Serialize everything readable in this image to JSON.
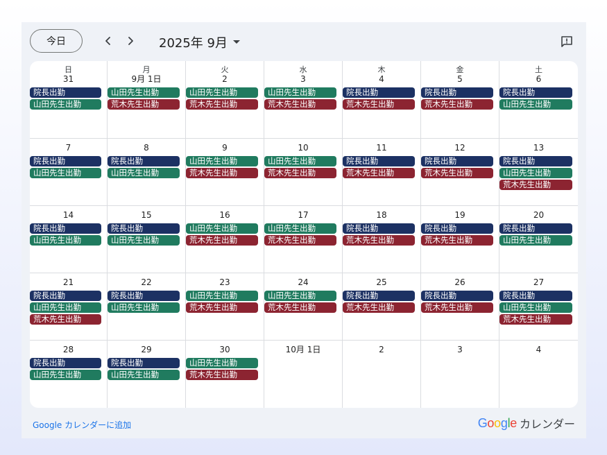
{
  "toolbar": {
    "today_label": "今日",
    "month_title": "2025年 9月"
  },
  "weekdays": [
    "日",
    "月",
    "火",
    "水",
    "木",
    "金",
    "土"
  ],
  "colors": {
    "director": "#1c3163",
    "yamada": "#207b5f",
    "araki": "#8c2431"
  },
  "weeks": [
    [
      {
        "day": "31",
        "events": [
          {
            "label": "院長出勤",
            "type": "director"
          },
          {
            "label": "山田先生出勤",
            "type": "yamada"
          }
        ]
      },
      {
        "day": "9月 1日",
        "events": [
          {
            "label": "山田先生出勤",
            "type": "yamada"
          },
          {
            "label": "荒木先生出勤",
            "type": "araki"
          }
        ]
      },
      {
        "day": "2",
        "events": [
          {
            "label": "山田先生出勤",
            "type": "yamada"
          },
          {
            "label": "荒木先生出勤",
            "type": "araki"
          }
        ]
      },
      {
        "day": "3",
        "events": [
          {
            "label": "山田先生出勤",
            "type": "yamada"
          },
          {
            "label": "荒木先生出勤",
            "type": "araki"
          }
        ]
      },
      {
        "day": "4",
        "events": [
          {
            "label": "院長出勤",
            "type": "director"
          },
          {
            "label": "荒木先生出勤",
            "type": "araki"
          }
        ]
      },
      {
        "day": "5",
        "events": [
          {
            "label": "院長出勤",
            "type": "director"
          },
          {
            "label": "荒木先生出勤",
            "type": "araki"
          }
        ]
      },
      {
        "day": "6",
        "events": [
          {
            "label": "院長出勤",
            "type": "director"
          },
          {
            "label": "山田先生出勤",
            "type": "yamada"
          }
        ]
      }
    ],
    [
      {
        "day": "7",
        "events": [
          {
            "label": "院長出勤",
            "type": "director"
          },
          {
            "label": "山田先生出勤",
            "type": "yamada"
          }
        ]
      },
      {
        "day": "8",
        "events": [
          {
            "label": "院長出勤",
            "type": "director"
          },
          {
            "label": "山田先生出勤",
            "type": "yamada"
          }
        ]
      },
      {
        "day": "9",
        "events": [
          {
            "label": "山田先生出勤",
            "type": "yamada"
          },
          {
            "label": "荒木先生出勤",
            "type": "araki"
          }
        ]
      },
      {
        "day": "10",
        "events": [
          {
            "label": "山田先生出勤",
            "type": "yamada"
          },
          {
            "label": "荒木先生出勤",
            "type": "araki"
          }
        ]
      },
      {
        "day": "11",
        "events": [
          {
            "label": "院長出勤",
            "type": "director"
          },
          {
            "label": "荒木先生出勤",
            "type": "araki"
          }
        ]
      },
      {
        "day": "12",
        "events": [
          {
            "label": "院長出勤",
            "type": "director"
          },
          {
            "label": "荒木先生出勤",
            "type": "araki"
          }
        ]
      },
      {
        "day": "13",
        "events": [
          {
            "label": "院長出勤",
            "type": "director"
          },
          {
            "label": "山田先生出勤",
            "type": "yamada"
          },
          {
            "label": "荒木先生出勤",
            "type": "araki"
          }
        ]
      }
    ],
    [
      {
        "day": "14",
        "events": [
          {
            "label": "院長出勤",
            "type": "director"
          },
          {
            "label": "山田先生出勤",
            "type": "yamada"
          }
        ]
      },
      {
        "day": "15",
        "events": [
          {
            "label": "院長出勤",
            "type": "director"
          },
          {
            "label": "山田先生出勤",
            "type": "yamada"
          }
        ]
      },
      {
        "day": "16",
        "events": [
          {
            "label": "山田先生出勤",
            "type": "yamada"
          },
          {
            "label": "荒木先生出勤",
            "type": "araki"
          }
        ]
      },
      {
        "day": "17",
        "events": [
          {
            "label": "山田先生出勤",
            "type": "yamada"
          },
          {
            "label": "荒木先生出勤",
            "type": "araki"
          }
        ]
      },
      {
        "day": "18",
        "events": [
          {
            "label": "院長出勤",
            "type": "director"
          },
          {
            "label": "荒木先生出勤",
            "type": "araki"
          }
        ]
      },
      {
        "day": "19",
        "events": [
          {
            "label": "院長出勤",
            "type": "director"
          },
          {
            "label": "荒木先生出勤",
            "type": "araki"
          }
        ]
      },
      {
        "day": "20",
        "events": [
          {
            "label": "院長出勤",
            "type": "director"
          },
          {
            "label": "山田先生出勤",
            "type": "yamada"
          }
        ]
      }
    ],
    [
      {
        "day": "21",
        "events": [
          {
            "label": "院長出勤",
            "type": "director"
          },
          {
            "label": "山田先生出勤",
            "type": "yamada"
          },
          {
            "label": "荒木先生出勤",
            "type": "araki"
          }
        ]
      },
      {
        "day": "22",
        "events": [
          {
            "label": "院長出勤",
            "type": "director"
          },
          {
            "label": "山田先生出勤",
            "type": "yamada"
          }
        ]
      },
      {
        "day": "23",
        "events": [
          {
            "label": "山田先生出勤",
            "type": "yamada"
          },
          {
            "label": "荒木先生出勤",
            "type": "araki"
          }
        ]
      },
      {
        "day": "24",
        "events": [
          {
            "label": "山田先生出勤",
            "type": "yamada"
          },
          {
            "label": "荒木先生出勤",
            "type": "araki"
          }
        ]
      },
      {
        "day": "25",
        "events": [
          {
            "label": "院長出勤",
            "type": "director"
          },
          {
            "label": "荒木先生出勤",
            "type": "araki"
          }
        ]
      },
      {
        "day": "26",
        "events": [
          {
            "label": "院長出勤",
            "type": "director"
          },
          {
            "label": "荒木先生出勤",
            "type": "araki"
          }
        ]
      },
      {
        "day": "27",
        "events": [
          {
            "label": "院長出勤",
            "type": "director"
          },
          {
            "label": "山田先生出勤",
            "type": "yamada"
          },
          {
            "label": "荒木先生出勤",
            "type": "araki"
          }
        ]
      }
    ],
    [
      {
        "day": "28",
        "events": [
          {
            "label": "院長出勤",
            "type": "director"
          },
          {
            "label": "山田先生出勤",
            "type": "yamada"
          }
        ]
      },
      {
        "day": "29",
        "events": [
          {
            "label": "院長出勤",
            "type": "director"
          },
          {
            "label": "山田先生出勤",
            "type": "yamada"
          }
        ]
      },
      {
        "day": "30",
        "events": [
          {
            "label": "山田先生出勤",
            "type": "yamada"
          },
          {
            "label": "荒木先生出勤",
            "type": "araki"
          }
        ]
      },
      {
        "day": "10月 1日",
        "events": []
      },
      {
        "day": "2",
        "events": []
      },
      {
        "day": "3",
        "events": []
      },
      {
        "day": "4",
        "events": []
      }
    ]
  ],
  "footer": {
    "add_link": "Google カレンダーに追加",
    "brand_text": "カレンダー"
  },
  "icons": {
    "prev": "chevron-left-icon",
    "next": "chevron-right-icon",
    "caret": "caret-down-icon",
    "feedback": "feedback-icon"
  }
}
